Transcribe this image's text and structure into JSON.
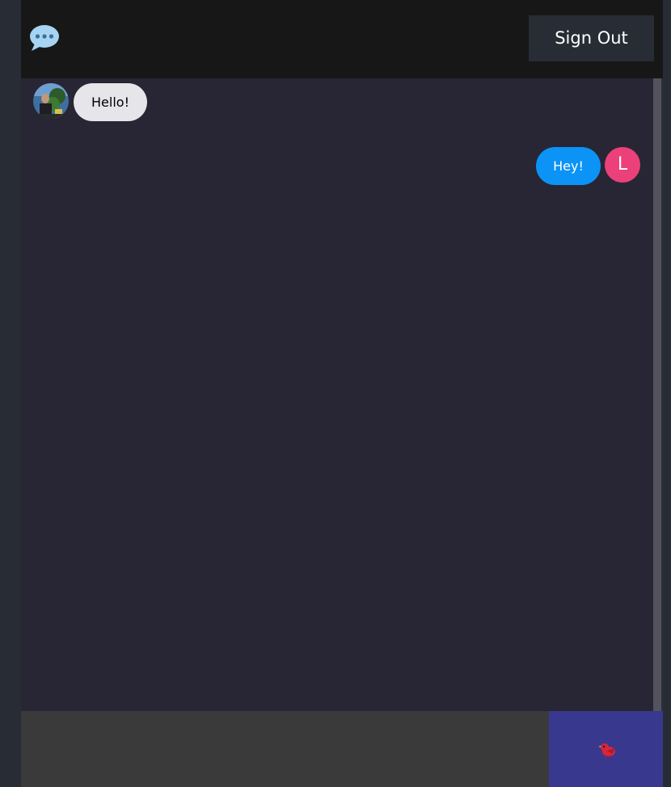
{
  "header": {
    "logo_icon": "speech-bubble-icon",
    "signout_label": "Sign Out"
  },
  "messages": [
    {
      "direction": "received",
      "text": "Hello!",
      "avatar": "photo"
    },
    {
      "direction": "sent",
      "text": "Hey!",
      "avatar_initial": "L"
    }
  ],
  "composer": {
    "input_value": "",
    "send_icon": "bird-icon"
  },
  "colors": {
    "header_bg": "#181717",
    "chat_bg": "#282634",
    "received_bubble": "#e5e5ea",
    "sent_bubble": "#0b93f6",
    "avatar_initial_bg": "#ec407a",
    "send_button": "#38388f",
    "input_bg": "#3a3a3a"
  }
}
